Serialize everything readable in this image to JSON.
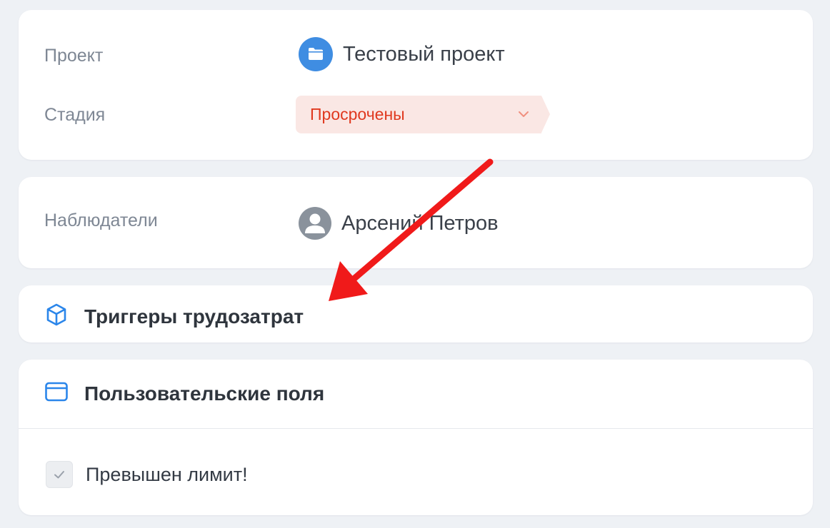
{
  "project": {
    "label": "Проект",
    "value": "Тестовый проект",
    "icon": "folder-icon"
  },
  "stage": {
    "label": "Стадия",
    "value": "Просрочены",
    "icon": "chevron-down-icon",
    "color": "#e0391f",
    "background": "#fae7e4"
  },
  "watchers": {
    "label": "Наблюдатели",
    "value": "Арсений Петров",
    "icon": "user-avatar-icon"
  },
  "triggers": {
    "title": "Триггеры трудозатрат",
    "icon": "cube-icon"
  },
  "custom_fields": {
    "title": "Пользовательские поля",
    "icon": "window-icon",
    "items": [
      {
        "label": "Превышен лимит!",
        "checked": true
      }
    ]
  },
  "annotation": {
    "type": "arrow",
    "color": "#f01a1a"
  }
}
